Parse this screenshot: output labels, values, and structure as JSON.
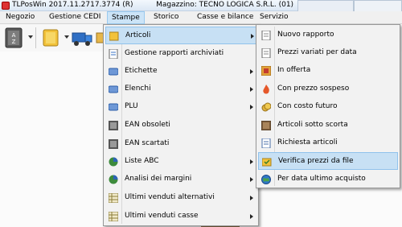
{
  "titlebar": {
    "title": "TLPosWin 2017.11.2717.3774 (R)          Magazzino: TECNO LOGICA S.R.L. (01)"
  },
  "menubar": {
    "items": [
      {
        "label": "Negozio"
      },
      {
        "label": "Gestione CEDI"
      },
      {
        "label": "Stampe"
      },
      {
        "label": "Storico"
      },
      {
        "label": "Casse e bilance"
      },
      {
        "label": "Servizio"
      }
    ]
  },
  "stampe_menu": {
    "items": [
      {
        "label": "Articoli",
        "icon": "folder-icon",
        "submenu": true,
        "highlighted": true
      },
      {
        "label": "Gestione rapporti archiviati",
        "icon": "report-icon",
        "submenu": false
      },
      {
        "label": "Etichette",
        "icon": "label-icon",
        "submenu": true
      },
      {
        "label": "Elenchi",
        "icon": "list-icon",
        "submenu": true
      },
      {
        "label": "PLU",
        "icon": "plu-icon",
        "submenu": true
      },
      {
        "label": "EAN obsoleti",
        "icon": "barcode-icon",
        "submenu": false
      },
      {
        "label": "EAN scartati",
        "icon": "barcode-icon",
        "submenu": false
      },
      {
        "label": "Liste ABC",
        "icon": "pie-chart-icon",
        "submenu": true
      },
      {
        "label": "Analisi dei margini",
        "icon": "pie-chart-icon",
        "submenu": true
      },
      {
        "label": "Ultimi venduti alternativi",
        "icon": "grid-icon",
        "submenu": true
      },
      {
        "label": "Ultimi venduti casse",
        "icon": "grid-icon",
        "submenu": true
      }
    ]
  },
  "articoli_submenu": {
    "items": [
      {
        "label": "Nuovo rapporto",
        "icon": "document-icon"
      },
      {
        "label": "Prezzi variati per data",
        "icon": "document-icon"
      },
      {
        "label": "In offerta",
        "icon": "offer-icon"
      },
      {
        "label": "Con prezzo sospeso",
        "icon": "flame-icon"
      },
      {
        "label": "Con costo futuro",
        "icon": "coins-icon"
      },
      {
        "label": "Articoli sotto scorta",
        "icon": "stock-icon"
      },
      {
        "label": "Richiesta articoli",
        "icon": "request-icon"
      },
      {
        "label": "Verifica prezzi da file",
        "icon": "file-check-icon",
        "highlighted": true
      },
      {
        "label": "Per data ultimo acquisto",
        "icon": "globe-icon"
      }
    ]
  },
  "colors": {
    "highlight": "#c7e0f4",
    "menu_bg": "#f2f2f2",
    "menubar_active": "#cce4f7"
  }
}
